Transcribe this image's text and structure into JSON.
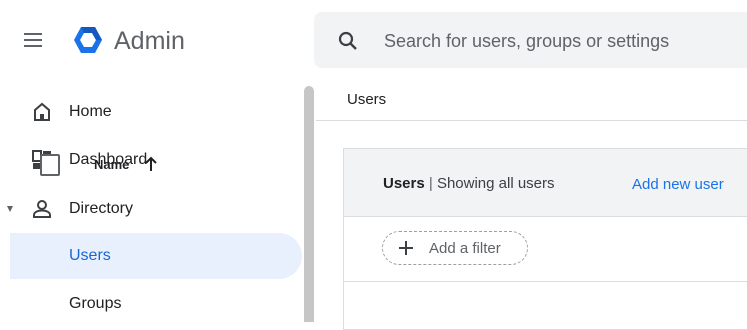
{
  "header": {
    "app_name": "Admin",
    "search_placeholder": "Search for users, groups or settings"
  },
  "sidebar": {
    "items": [
      {
        "label": "Home",
        "icon": "home-icon"
      },
      {
        "label": "Dashboard",
        "icon": "dashboard-icon"
      },
      {
        "label": "Directory",
        "icon": "person-icon",
        "expanded": true
      },
      {
        "label": "Users",
        "active": true
      },
      {
        "label": "Groups"
      }
    ]
  },
  "main": {
    "breadcrumb": "Users",
    "card": {
      "title_bold": "Users",
      "separator": "|",
      "title_sub": "Showing all users",
      "add_user_label": "Add new user",
      "filter_label": "Add a filter",
      "column_name": "Name"
    }
  },
  "colors": {
    "accent": "#1a73e8",
    "active_bg": "#e8f0fe",
    "logo": "#1a73e8"
  }
}
